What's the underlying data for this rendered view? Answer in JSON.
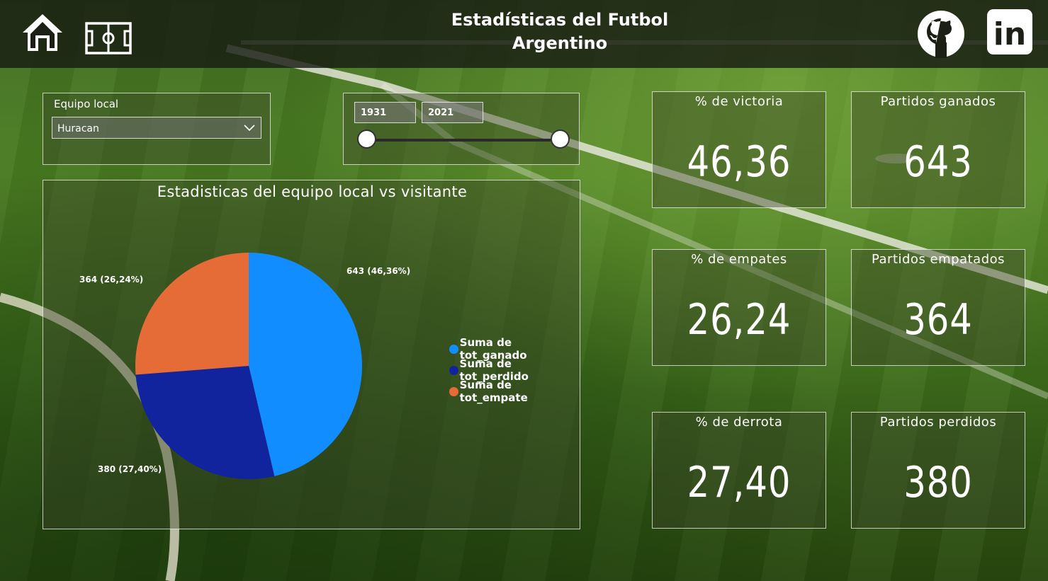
{
  "header": {
    "title_line1": "Estadísticas del Futbol",
    "title_line2": "Argentino",
    "icons": [
      "home-icon",
      "soccer-field-icon",
      "github-icon",
      "linkedin-icon"
    ],
    "linkedin_text": "in"
  },
  "filters": {
    "team": {
      "label": "Equipo local",
      "selected": "Huracan"
    },
    "years": {
      "start": "1931",
      "end": "2021"
    }
  },
  "chart": {
    "title": "Estadisticas del equipo local vs visitante"
  },
  "chart_data": {
    "type": "pie",
    "title": "Estadisticas del equipo local vs visitante",
    "labels": [
      "Suma de tot_ganado",
      "Suma de tot_perdido",
      "Suma de tot_empate"
    ],
    "values": [
      643,
      380,
      364
    ],
    "percentages": [
      "46,36%",
      "27,40%",
      "26,24%"
    ],
    "data_labels": [
      "643 (46,36%)",
      "380 (27,40%)",
      "364 (26,24%)"
    ],
    "colors": [
      "#118dff",
      "#12239e",
      "#e66c37"
    ],
    "legend_position": "right"
  },
  "cards": [
    {
      "label": "% de victoria",
      "value": "46,36"
    },
    {
      "label": "Partidos ganados",
      "value": "643"
    },
    {
      "label": "% de empates",
      "value": "26,24"
    },
    {
      "label": "Partidos empatados",
      "value": "364"
    },
    {
      "label": "% de derrota",
      "value": "27,40"
    },
    {
      "label": "Partidos perdidos",
      "value": "380"
    }
  ]
}
